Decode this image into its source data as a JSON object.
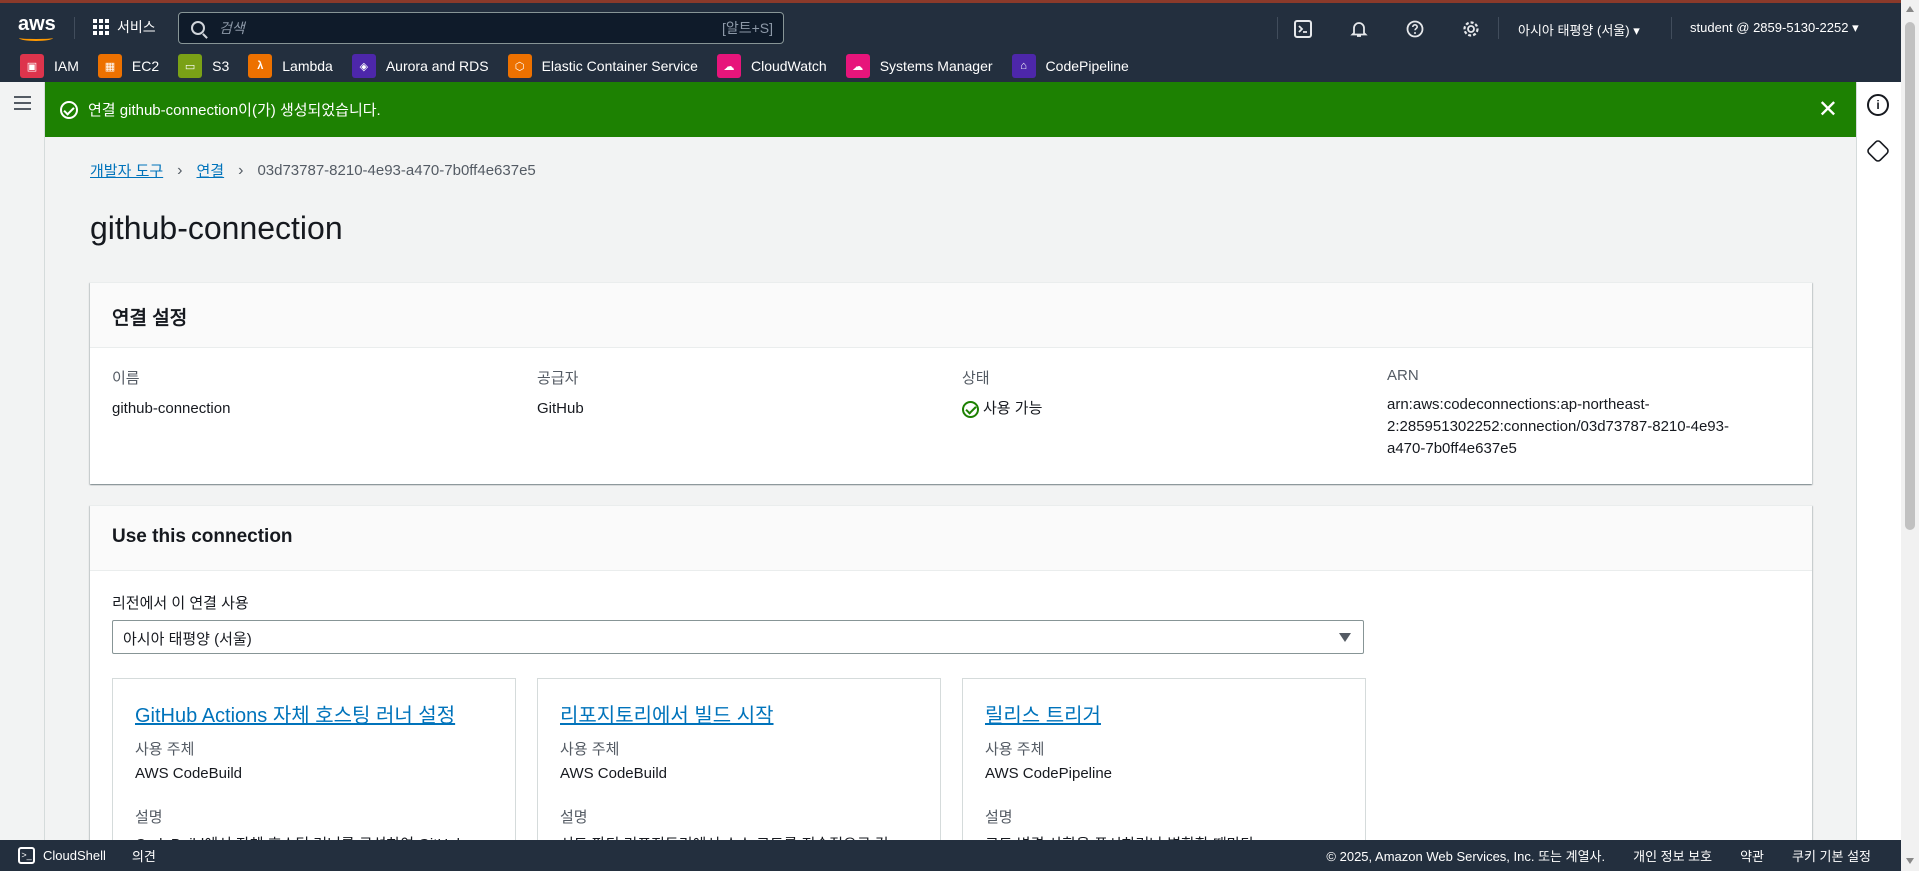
{
  "topnav": {
    "logo": "aws",
    "services_label": "서비스",
    "search_placeholder": "검색",
    "search_shortcut": "[알트+S]",
    "region": "아시아 태평양 (서울)",
    "account": "student @ 2859-5130-2252"
  },
  "favorites": [
    {
      "label": "IAM",
      "color": "#dd344c",
      "icon": "iam-icon"
    },
    {
      "label": "EC2",
      "color": "#ed7100",
      "icon": "ec2-icon"
    },
    {
      "label": "S3",
      "color": "#7aa116",
      "icon": "s3-icon"
    },
    {
      "label": "Lambda",
      "color": "#ed7100",
      "icon": "lambda-icon"
    },
    {
      "label": "Aurora and RDS",
      "color": "#4d27aa",
      "icon": "rds-icon"
    },
    {
      "label": "Elastic Container Service",
      "color": "#ed7100",
      "icon": "ecs-icon"
    },
    {
      "label": "CloudWatch",
      "color": "#e7157b",
      "icon": "cloudwatch-icon"
    },
    {
      "label": "Systems Manager",
      "color": "#e7157b",
      "icon": "ssm-icon"
    },
    {
      "label": "CodePipeline",
      "color": "#4d27aa",
      "icon": "codepipeline-icon"
    }
  ],
  "flash": {
    "message": "연결 github-connection이(가) 생성되었습니다."
  },
  "breadcrumb": {
    "item1": "개발자 도구",
    "item2": "연결",
    "current": "03d73787-8210-4e93-a470-7b0ff4e637e5"
  },
  "page_title": "github-connection",
  "settings": {
    "heading": "연결 설정",
    "name_label": "이름",
    "name_value": "github-connection",
    "provider_label": "공급자",
    "provider_value": "GitHub",
    "status_label": "상태",
    "status_value": "사용 가능",
    "arn_label": "ARN",
    "arn_line1": "arn:aws:codeconnections:ap-northeast-",
    "arn_line2": "2:285951302252:connection/03d73787-8210-4e93-",
    "arn_line3": "a470-7b0ff4e637e5"
  },
  "use": {
    "heading": "Use this connection",
    "region_label": "리전에서 이 연결 사용",
    "region_value": "아시아 태평양 (서울)",
    "cards": [
      {
        "title": "GitHub Actions 자체 호스팅 러너 설정",
        "used_by_label": "사용 주체",
        "used_by": "AWS CodeBuild",
        "desc_label": "설명",
        "desc": "CodeBuild에서 자체 호스팅 러너를 구성하여 GitHub"
      },
      {
        "title": "리포지토리에서 빌드 시작",
        "used_by_label": "사용 주체",
        "used_by": "AWS CodeBuild",
        "desc_label": "설명",
        "desc": "서드 파티 리포지토리에서 소스 코드를 지속적으로 컴"
      },
      {
        "title": "릴리스 트리거",
        "used_by_label": "사용 주체",
        "used_by": "AWS CodePipeline",
        "desc_label": "설명",
        "desc": "코드 변경 사항을 푸시하거나 병합할 때마다"
      }
    ]
  },
  "footer": {
    "cloudshell": "CloudShell",
    "feedback": "의견",
    "copyright": "© 2025, Amazon Web Services, Inc. 또는 계열사.",
    "privacy": "개인 정보 보호",
    "terms": "약관",
    "cookies": "쿠키 기본 설정"
  }
}
